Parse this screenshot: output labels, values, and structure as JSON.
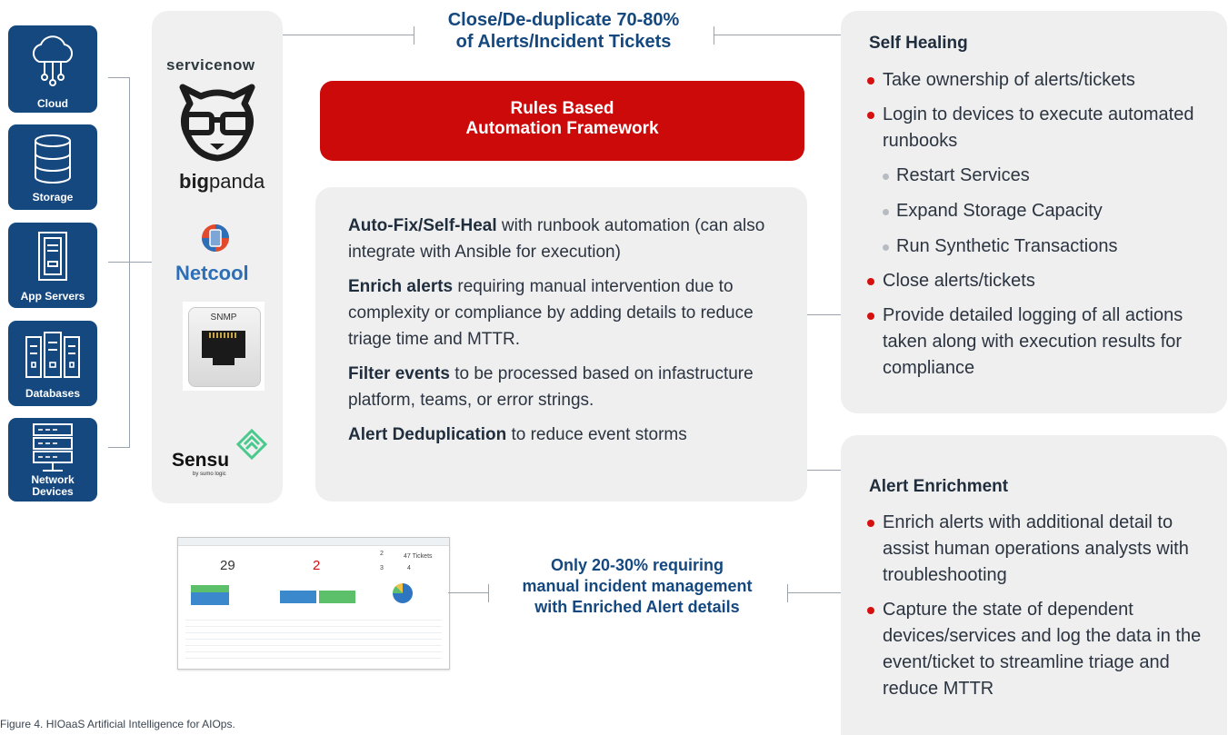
{
  "sources": [
    {
      "label": "Cloud",
      "icon": "cloud-icon"
    },
    {
      "label": "Storage",
      "icon": "storage-icon"
    },
    {
      "label": "App Servers",
      "icon": "app-server-icon"
    },
    {
      "label": "Databases",
      "icon": "database-icon"
    },
    {
      "label": "Network Devices",
      "icon": "network-device-icon"
    }
  ],
  "tools": {
    "servicenow": "servicenow",
    "bigpanda_bold": "big",
    "bigpanda_rest": "panda",
    "netcool": "Netcool",
    "snmp": "SNMP",
    "sensu": "Sensu",
    "sensu_sub": "by sumo logic"
  },
  "top_callout": {
    "line1": "Close/De-duplicate 70-80%",
    "line2": "of Alerts/Incident Tickets"
  },
  "rules_box": {
    "line1": "Rules Based",
    "line2": "Automation Framework"
  },
  "capabilities": [
    {
      "bold": "Auto-Fix/Self-Heal",
      "text": " with runbook automation (can also integrate with Ansible for execution)"
    },
    {
      "bold": "Enrich alerts",
      "text": " requiring manual intervention due to complexity or compliance by adding details to reduce triage time and MTTR."
    },
    {
      "bold": "Filter events",
      "text": " to be processed based on infastructure platform, teams, or error strings."
    },
    {
      "bold": "Alert Deduplication",
      "text": " to reduce event storms"
    }
  ],
  "self_healing": {
    "title": "Self Healing",
    "items": [
      {
        "text": "Take ownership of alerts/tickets",
        "sub": false
      },
      {
        "text": "Login to devices to execute automated runbooks",
        "sub": false
      },
      {
        "text": "Restart Services",
        "sub": true
      },
      {
        "text": "Expand Storage Capacity",
        "sub": true
      },
      {
        "text": "Run Synthetic Transactions",
        "sub": true
      },
      {
        "text": "Close alerts/tickets",
        "sub": false
      },
      {
        "text": "Provide detailed logging of all actions taken along with execution results for compliance",
        "sub": false
      }
    ]
  },
  "alert_enrichment": {
    "title": "Alert Enrichment",
    "items": [
      {
        "text": "Enrich alerts with additional detail to assist human operations analysts with troubleshooting",
        "sub": false
      },
      {
        "text": "Capture the state of dependent devices/services and log the data in the event/ticket to streamline triage and reduce MTTR",
        "sub": false
      }
    ]
  },
  "dashboard": {
    "count_total": "29",
    "count_red": "2",
    "small_1": "2",
    "small_2": "3",
    "small_3": "4",
    "small_4": "47 Tickets"
  },
  "bottom_callout": {
    "line1": "Only 20-30% requiring",
    "line2": "manual incident management",
    "line3": "with Enriched Alert details"
  },
  "caption": "Figure 4. HIOaaS Artificial Intelligence for AIOps.",
  "colors": {
    "navy": "#15487f",
    "red": "#d60f0f",
    "panel_gray": "#efefef",
    "line_gray": "#9aa2ab"
  }
}
